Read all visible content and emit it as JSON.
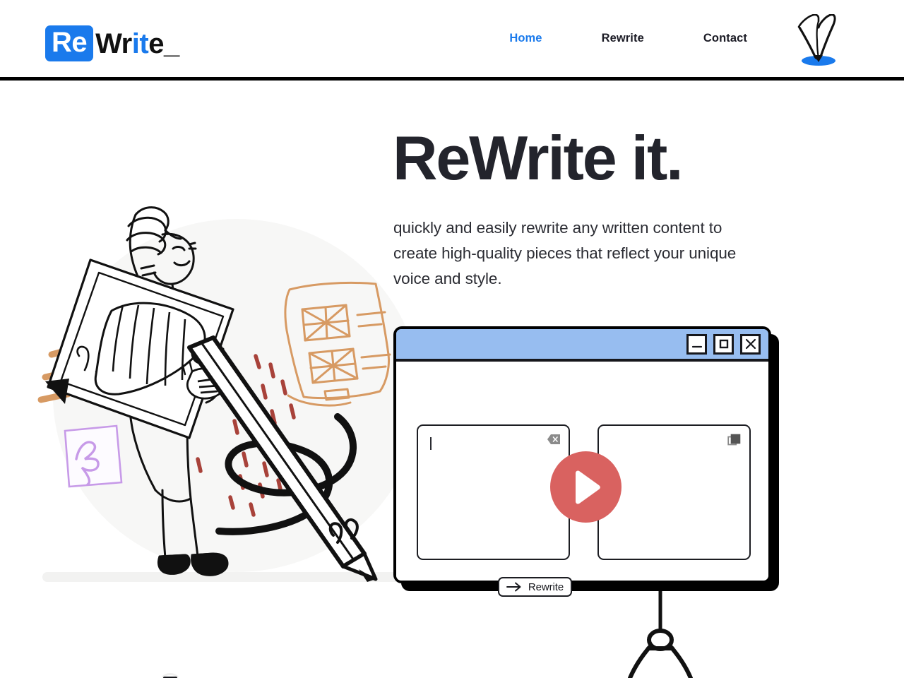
{
  "brand": {
    "badge_text": "Re",
    "part_dark": "Wr",
    "part_blue": "it",
    "part_tail": "e",
    "underscore": "_",
    "accent_blue": "#1a7aec",
    "icon_name": "pen-logo-icon"
  },
  "nav": {
    "items": [
      {
        "label": "Home",
        "active": true
      },
      {
        "label": "Rewrite",
        "active": false
      },
      {
        "label": "Contact",
        "active": false
      }
    ]
  },
  "hero": {
    "title": "ReWrite it.",
    "subtitle": "quickly and easily rewrite any written content to create high-quality pieces that reflect your unique voice and style."
  },
  "app_window": {
    "titlebar": {
      "color": "#97bdf0",
      "minimize_label": "Minimize",
      "maximize_label": "Maximize",
      "close_label": "Close"
    },
    "input_pane": {
      "placeholder": "",
      "value": "",
      "clear_icon": "clear-backspace-icon"
    },
    "output_pane": {
      "value": "",
      "copy_icon": "copy-icon"
    },
    "action_button": {
      "label": "Rewrite",
      "icon": "arrow-right-icon"
    },
    "play_button": {
      "label": "Play",
      "color": "#d96260",
      "icon": "play-triangle-icon"
    }
  },
  "illustration": {
    "name": "person-holding-document-illustration",
    "accents": {
      "paper_orange": "#d79a63",
      "sticky_purple": "#c79ae8",
      "dash_red": "#a8423a",
      "ink_black": "#111111",
      "blob_grey": "#f6f6f5"
    }
  }
}
